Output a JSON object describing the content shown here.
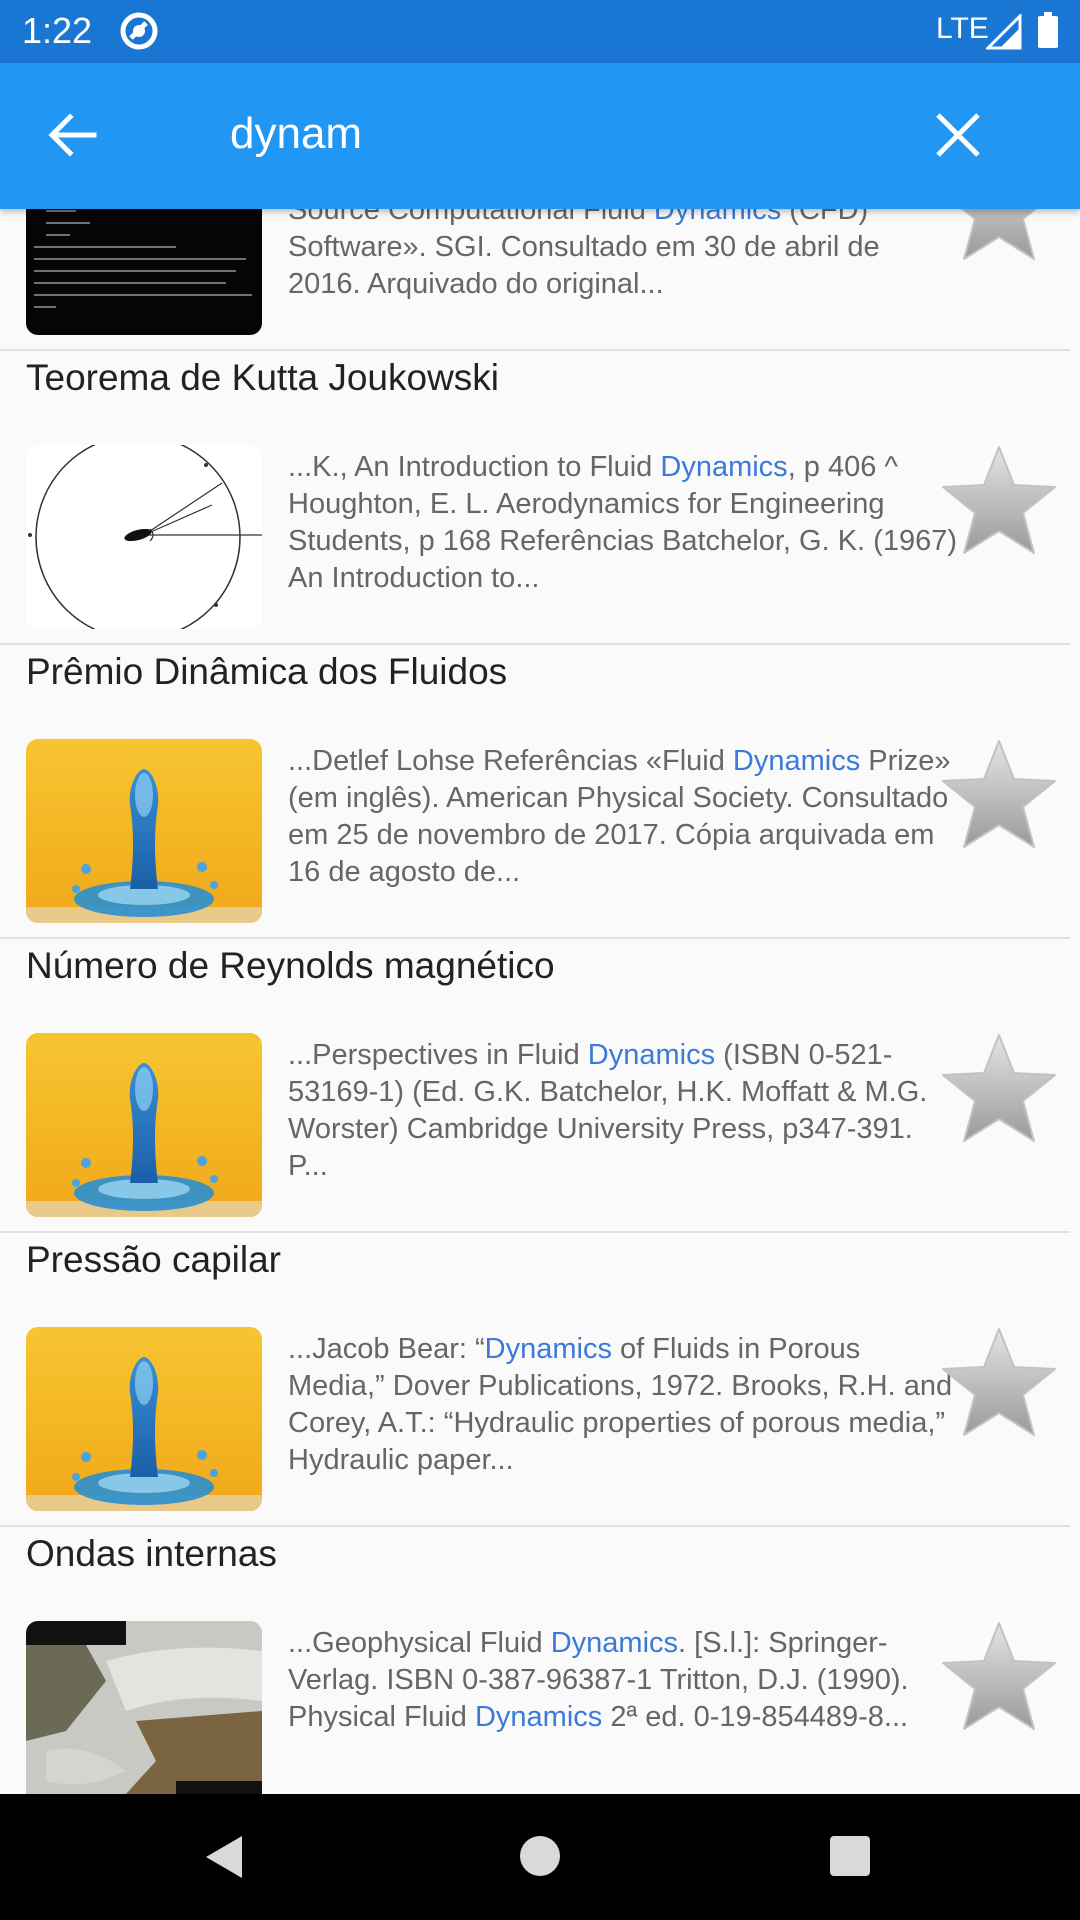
{
  "status_bar": {
    "time": "1:22",
    "network": "LTE"
  },
  "search": {
    "query": "dynam"
  },
  "results": [
    {
      "title": "",
      "thumb": "code-screenshot",
      "snippet": [
        {
          "t": "...SGI Acquires OpenCFD Ltd., the Leader in Open Source Computational Fluid "
        },
        {
          "t": "Dynamics",
          "hl": true
        },
        {
          "t": " (CFD) Software». SGI. Consultado em 30 de abril de 2016. Arquivado do original..."
        }
      ]
    },
    {
      "title": "Teorema de Kutta Joukowski",
      "thumb": "circle-diagram",
      "snippet": [
        {
          "t": "...K., An Introduction to Fluid "
        },
        {
          "t": "Dynamics",
          "hl": true
        },
        {
          "t": ", p 406 ^ Houghton, E. L. Aerodynamics for Engineering Students, p 168 Referências Batchelor, G. K. (1967) An Introduction to..."
        }
      ]
    },
    {
      "title": "Prêmio Dinâmica dos Fluidos",
      "thumb": "water-drop",
      "snippet": [
        {
          "t": "...Detlef Lohse Referências «Fluid "
        },
        {
          "t": "Dynamics",
          "hl": true
        },
        {
          "t": " Prize» (em inglês). American Physical Society. Consultado em 25 de novembro de 2017. Cópia arquivada em 16 de agosto de..."
        }
      ]
    },
    {
      "title": "Número de Reynolds magnético",
      "thumb": "water-drop",
      "snippet": [
        {
          "t": "...Perspectives in Fluid "
        },
        {
          "t": "Dynamics",
          "hl": true
        },
        {
          "t": " (ISBN 0-521-53169-1) (Ed. G.K. Batchelor, H.K. Moffatt & M.G. Worster) Cambridge University Press, p347-391. P..."
        }
      ]
    },
    {
      "title": "Pressão capilar",
      "thumb": "water-drop",
      "snippet": [
        {
          "t": "...Jacob Bear: “"
        },
        {
          "t": "Dynamics",
          "hl": true
        },
        {
          "t": " of Fluids in Porous Media,” Dover Publications, 1972. Brooks, R.H. and Corey, A.T.: “Hydraulic properties of porous media,” Hydraulic paper..."
        }
      ]
    },
    {
      "title": "Ondas internas",
      "thumb": "satellite",
      "snippet": [
        {
          "t": "...Geophysical Fluid "
        },
        {
          "t": "Dynamics",
          "hl": true
        },
        {
          "t": ". [S.l.]: Springer-Verlag. ISBN 0-387-96387-1 Tritton, D.J. (1990). Physical Fluid "
        },
        {
          "t": "Dynamics",
          "hl": true
        },
        {
          "t": " 2ª ed. 0-19-854489-8..."
        }
      ]
    }
  ]
}
